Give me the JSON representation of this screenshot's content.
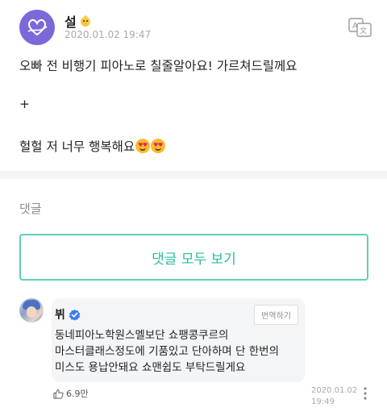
{
  "post": {
    "author": "설",
    "date": "2020.01.02 19:47",
    "lines": [
      "오빠 전 비행기 피아노로 칠줄알아요! 가르쳐드릴께요",
      "+",
      "헐헐 저 너무 행복해요"
    ],
    "emojis": [
      "smiling-face-with-heart-eyes",
      "smiling-face-with-heart-eyes"
    ],
    "icons": {
      "avatar": "purple-heart-logo-icon",
      "badge": "yellow-chick-icon",
      "translate": "translate-icon"
    }
  },
  "comments_section": {
    "label": "댓글",
    "view_all_label": "댓글 모두 보기"
  },
  "comment": {
    "author": "뷔",
    "translate_label": "번역하기",
    "lines": [
      "동네피아노학원스멜보단 쇼팽콩쿠르의",
      "마스터클래스정도에 기품있고 단아하며 단 한번의",
      "미스도 용납안돼요 쇼맨쉽도 부탁드릴게요"
    ],
    "likes": "6.9만",
    "date_line1": "2020.01.02",
    "date_line2": "19:49",
    "icons": {
      "verified": "verified-check-icon",
      "like": "thumbs-up-icon",
      "more": "more-vertical-icon"
    }
  },
  "colors": {
    "accent": "#2bbd9a",
    "accent_border": "#5fd0b4",
    "verified": "#3a7bf0",
    "bubble": "#f4f5f7"
  }
}
